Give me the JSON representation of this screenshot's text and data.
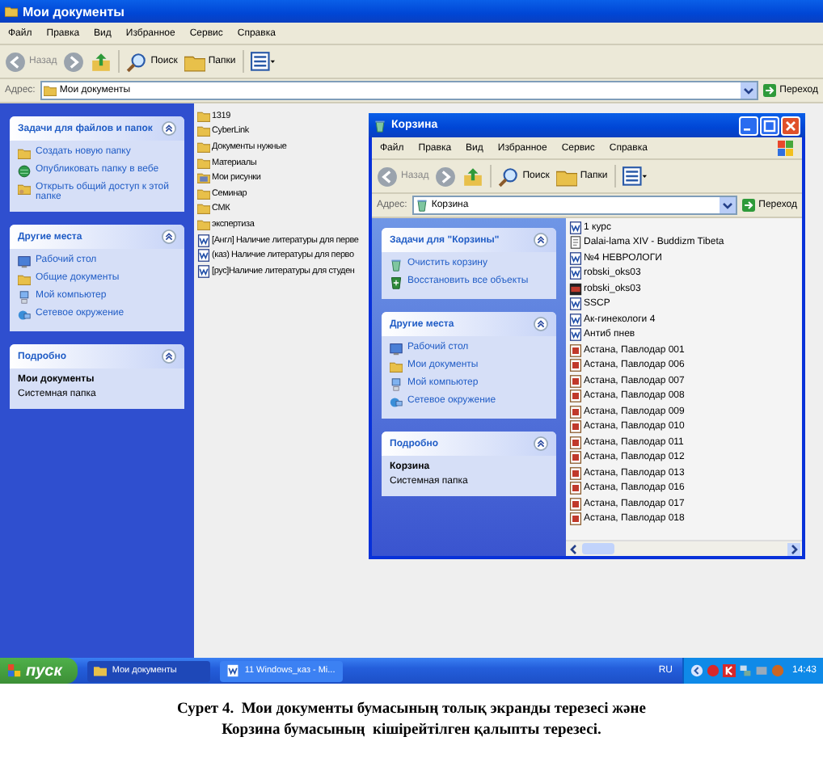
{
  "windows": [
    {
      "kind": "maximized",
      "title": "Мои документы",
      "menu": [
        "Файл",
        "Правка",
        "Вид",
        "Избранное",
        "Сервис",
        "Справка"
      ],
      "toolbar": {
        "back": "Назад",
        "search": "Поиск",
        "folders": "Папки"
      },
      "address": {
        "label": "Адрес:",
        "value": "Мои документы",
        "go": "Переход"
      },
      "panels": [
        {
          "title": "Задачи для файлов и папок",
          "links": [
            {
              "label": "Создать новую папку",
              "kind": "folder"
            },
            {
              "label": "Опубликовать папку в вебе",
              "kind": "globe"
            },
            {
              "label": "Открыть общий доступ к этой папке",
              "kind": "share"
            }
          ]
        },
        {
          "title": "Другие места",
          "links": [
            {
              "label": "Рабочий стол",
              "kind": "desktop"
            },
            {
              "label": "Общие документы",
              "kind": "folder"
            },
            {
              "label": "Мой компьютер",
              "kind": "computer"
            },
            {
              "label": "Сетевое окружение",
              "kind": "network"
            }
          ]
        },
        {
          "title": "Подробно",
          "name": "Мои документы",
          "description": "Системная папка"
        }
      ],
      "files": [
        {
          "name": "1319",
          "kind": "folder"
        },
        {
          "name": "CyberLink",
          "kind": "folder"
        },
        {
          "name": "Документы нужные",
          "kind": "folder"
        },
        {
          "name": "Материалы",
          "kind": "folder"
        },
        {
          "name": "Мои рисунки",
          "kind": "pictures"
        },
        {
          "name": "Семинар",
          "kind": "folder"
        },
        {
          "name": "СМК",
          "kind": "folder"
        },
        {
          "name": "экспертиза",
          "kind": "folder"
        },
        {
          "name": "[Англ] Наличие литературы для перве",
          "kind": "doc"
        },
        {
          "name": "(каз) Наличие литературы для перво",
          "kind": "doc"
        },
        {
          "name": "[рус]Наличие литературы для студен",
          "kind": "doc"
        }
      ]
    },
    {
      "kind": "floating",
      "title": "Корзина",
      "menu": [
        "Файл",
        "Правка",
        "Вид",
        "Избранное",
        "Сервис",
        "Справка"
      ],
      "toolbar": {
        "back": "Назад",
        "search": "Поиск",
        "folders": "Папки"
      },
      "address": {
        "label": "Адрес:",
        "value": "Корзина",
        "go": "Переход"
      },
      "panels": [
        {
          "title": "Задачи для \"Корзины\"",
          "links": [
            {
              "label": "Очистить корзину",
              "kind": "bin"
            },
            {
              "label": "Восстановить все объекты",
              "kind": "restore"
            }
          ]
        },
        {
          "title": "Другие места",
          "links": [
            {
              "label": "Рабочий стол",
              "kind": "desktop"
            },
            {
              "label": "Мои документы",
              "kind": "folder"
            },
            {
              "label": "Мой компьютер",
              "kind": "computer"
            },
            {
              "label": "Сетевое окружение",
              "kind": "network"
            }
          ]
        },
        {
          "title": "Подробно",
          "name": "Корзина",
          "description": "Системная папка"
        }
      ],
      "files": [
        {
          "name": "1 курс",
          "kind": "doc"
        },
        {
          "name": "Dalai-lama XIV - Buddizm Tibeta",
          "kind": "text"
        },
        {
          "name": "№4 НЕВРОЛОГИ",
          "kind": "doc"
        },
        {
          "name": "robski_oks03",
          "kind": "doc"
        },
        {
          "name": "robski_oks03",
          "kind": "media"
        },
        {
          "name": "SSCP",
          "kind": "doc"
        },
        {
          "name": "Ак-гинекологи 4",
          "kind": "doc"
        },
        {
          "name": "Антиб пнев",
          "kind": "doc"
        },
        {
          "name": "Астана, Павлодар 001",
          "kind": "image"
        },
        {
          "name": "Астана, Павлодар 006",
          "kind": "image"
        },
        {
          "name": "Астана, Павлодар 007",
          "kind": "image"
        },
        {
          "name": "Астана, Павлодар 008",
          "kind": "image"
        },
        {
          "name": "Астана, Павлодар 009",
          "kind": "image"
        },
        {
          "name": "Астана, Павлодар 010",
          "kind": "image"
        },
        {
          "name": "Астана, Павлодар 011",
          "kind": "image"
        },
        {
          "name": "Астана, Павлодар 012",
          "kind": "image"
        },
        {
          "name": "Астана, Павлодар 013",
          "kind": "image"
        },
        {
          "name": "Астана, Павлодар 016",
          "kind": "image"
        },
        {
          "name": "Астана, Павлодар 017",
          "kind": "image"
        },
        {
          "name": "Астана, Павлодар 018",
          "kind": "image"
        }
      ]
    }
  ],
  "taskbar": {
    "start": "пуск",
    "buttons": [
      {
        "label": "Мои документы",
        "selected": true
      },
      {
        "label": "11 Windows_каз - Mi...",
        "selected": false
      }
    ],
    "language": "RU",
    "clock": "14:43"
  },
  "caption": [
    "Сурет 4.  Мои документы бумасының толық экранды терезесі және",
    "Корзина бумасының  кішірейтілген қалыпты терезесі."
  ]
}
